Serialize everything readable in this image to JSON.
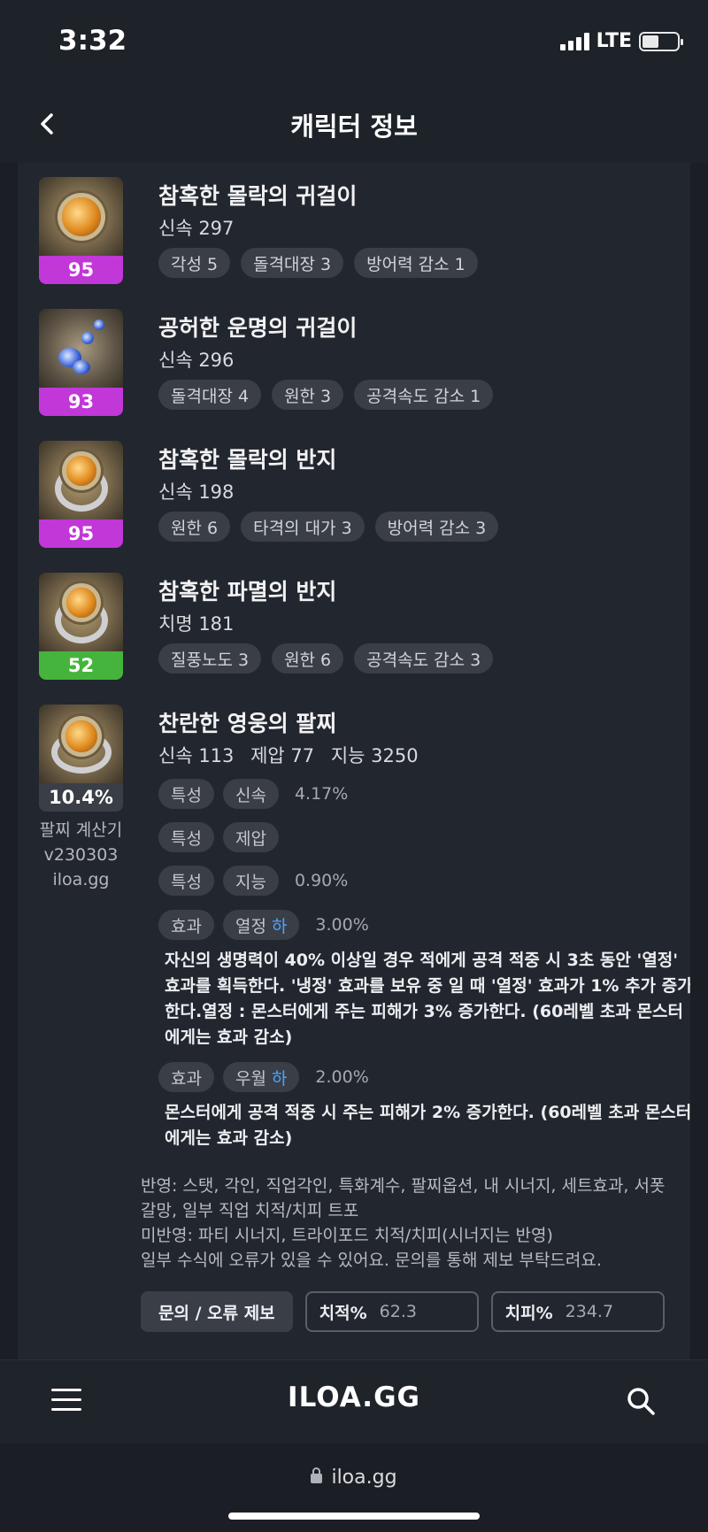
{
  "status": {
    "time": "3:32",
    "network": "LTE"
  },
  "header": {
    "title": "캐릭터 정보"
  },
  "items": [
    {
      "name": "참혹한 몰락의 귀걸이",
      "stats": [
        "신속 297"
      ],
      "level": "95",
      "tags": [
        "각성 5",
        "돌격대장 3",
        "방어력 감소 1"
      ]
    },
    {
      "name": "공허한 운명의 귀걸이",
      "stats": [
        "신속 296"
      ],
      "level": "93",
      "tags": [
        "돌격대장 4",
        "원한 3",
        "공격속도 감소 1"
      ]
    },
    {
      "name": "참혹한 몰락의 반지",
      "stats": [
        "신속 198"
      ],
      "level": "95",
      "tags": [
        "원한 6",
        "타격의 대가 3",
        "방어력 감소 3"
      ]
    },
    {
      "name": "참혹한 파멸의 반지",
      "stats": [
        "치명 181"
      ],
      "level": "52",
      "tags": [
        "질풍노도 3",
        "원한 6",
        "공격속도 감소 3"
      ]
    }
  ],
  "bracelet": {
    "name": "찬란한 영웅의 팔찌",
    "stats": [
      "신속 113",
      "제압 77",
      "지능 3250"
    ],
    "percent": "10.4%",
    "calc_lines": [
      "팔찌 계산기",
      "v230303",
      "iloa.gg"
    ],
    "traits": [
      {
        "type": "특성",
        "name": "신속",
        "value": "4.17%"
      },
      {
        "type": "특성",
        "name": "제압",
        "value": ""
      },
      {
        "type": "특성",
        "name": "지능",
        "value": "0.90%"
      }
    ],
    "effects": [
      {
        "type": "효과",
        "name": "열정",
        "grade": "하",
        "value": "3.00%",
        "desc": "자신의 생명력이 40% 이상일 경우 적에게 공격 적중 시 3초 동안 '열정' 효과를 획득한다. '냉정' 효과를 보유 중 일 때 '열정' 효과가 1% 추가 증가한다.열정 : 몬스터에게 주는 피해가 3% 증가한다. (60레벨 초과 몬스터에게는 효과 감소)"
      },
      {
        "type": "효과",
        "name": "우월",
        "grade": "하",
        "value": "2.00%",
        "desc": "몬스터에게 공격 적중 시 주는 피해가 2% 증가한다. (60레벨 초과 몬스터에게는 효과 감소)"
      }
    ],
    "notes": [
      "반영: 스탯, 각인, 직업각인, 특화계수, 팔찌옵션, 내 시너지, 세트효과, 서폿 갈망, 일부 직업 치적/치피 트포",
      "미반영: 파티 시너지, 트라이포드 치적/치피(시너지는 반영)",
      "일부 수식에 오류가 있을 수 있어요. 문의를 통해 제보 부탁드려요."
    ],
    "report_label": "문의 / 오류 제보",
    "crit_rate_label": "치적%",
    "crit_rate_value": "62.3",
    "crit_dmg_label": "치피%",
    "crit_dmg_value": "234.7"
  },
  "bottom": {
    "logo": "ILOA.GG",
    "url": "iloa.gg"
  }
}
